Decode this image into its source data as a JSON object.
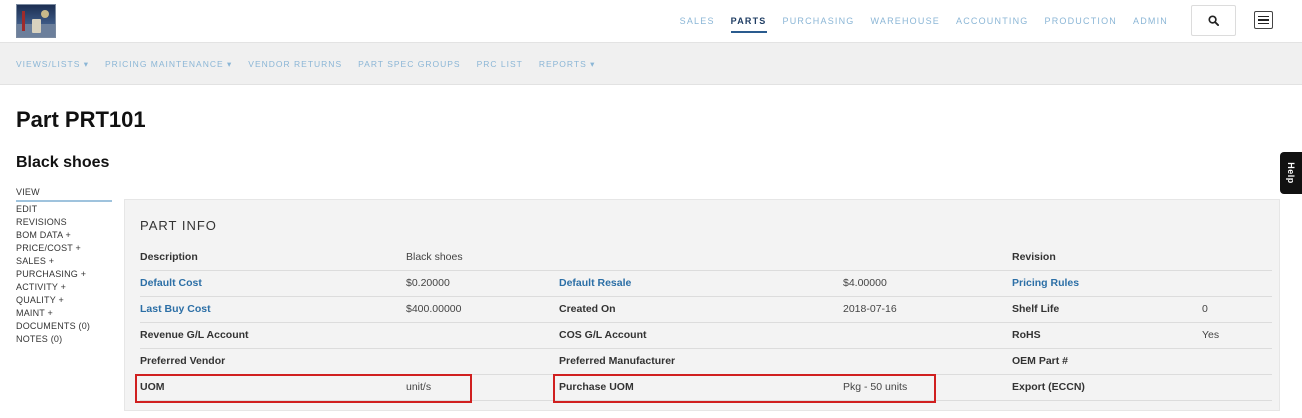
{
  "topnav": {
    "items": [
      "SALES",
      "PARTS",
      "PURCHASING",
      "WAREHOUSE",
      "ACCOUNTING",
      "PRODUCTION",
      "ADMIN"
    ],
    "active": "PARTS"
  },
  "subnav": {
    "items": [
      "VIEWS/LISTS ▾",
      "PRICING MAINTENANCE ▾",
      "VENDOR RETURNS",
      "PART SPEC GROUPS",
      "PRC LIST",
      "REPORTS ▾"
    ]
  },
  "page": {
    "title": "Part PRT101",
    "subtitle": "Black shoes"
  },
  "sidenav": {
    "items": [
      "VIEW",
      "EDIT",
      "REVISIONS",
      "BOM DATA +",
      "PRICE/COST +",
      "SALES +",
      "PURCHASING +",
      "ACTIVITY +",
      "QUALITY +",
      "MAINT +",
      "DOCUMENTS (0)",
      "NOTES (0)"
    ],
    "active": "VIEW"
  },
  "help": {
    "label": "Help"
  },
  "part_info": {
    "title": "PART INFO",
    "rows": [
      [
        {
          "t": "Description",
          "k": "lbl"
        },
        {
          "t": "Black shoes",
          "k": "val"
        },
        {
          "t": "",
          "k": "lbl"
        },
        {
          "t": "",
          "k": "val"
        },
        {
          "t": "Revision",
          "k": "lbl"
        },
        {
          "t": "",
          "k": "val"
        }
      ],
      [
        {
          "t": "Default Cost",
          "k": "link"
        },
        {
          "t": "$0.20000",
          "k": "val"
        },
        {
          "t": "Default Resale",
          "k": "link"
        },
        {
          "t": "$4.00000",
          "k": "val"
        },
        {
          "t": "Pricing Rules",
          "k": "link"
        },
        {
          "t": "",
          "k": "val"
        }
      ],
      [
        {
          "t": "Last Buy Cost",
          "k": "link"
        },
        {
          "t": "$400.00000",
          "k": "val"
        },
        {
          "t": "Created On",
          "k": "lbl"
        },
        {
          "t": "2018-07-16",
          "k": "val"
        },
        {
          "t": "Shelf Life",
          "k": "lbl"
        },
        {
          "t": "0",
          "k": "val"
        }
      ],
      [
        {
          "t": "Revenue G/L Account",
          "k": "lbl"
        },
        {
          "t": "",
          "k": "val"
        },
        {
          "t": "COS G/L Account",
          "k": "lbl"
        },
        {
          "t": "",
          "k": "val"
        },
        {
          "t": "RoHS",
          "k": "lbl"
        },
        {
          "t": "Yes",
          "k": "val"
        }
      ],
      [
        {
          "t": "Preferred Vendor",
          "k": "lbl"
        },
        {
          "t": "",
          "k": "val"
        },
        {
          "t": "Preferred Manufacturer",
          "k": "lbl"
        },
        {
          "t": "",
          "k": "val"
        },
        {
          "t": "OEM Part #",
          "k": "lbl"
        },
        {
          "t": "",
          "k": "val"
        }
      ],
      [
        {
          "t": "UOM",
          "k": "lbl"
        },
        {
          "t": "unit/s",
          "k": "val"
        },
        {
          "t": "Purchase UOM",
          "k": "lbl"
        },
        {
          "t": "Pkg - 50 units",
          "k": "val"
        },
        {
          "t": "Export (ECCN)",
          "k": "lbl"
        },
        {
          "t": "",
          "k": "val"
        }
      ]
    ]
  },
  "colors": {
    "accent": "#2c6fa6",
    "nav_link": "#8bb6d6",
    "highlight": "#d01f1f",
    "panel_bg": "#f3f3f3"
  },
  "icons": {
    "search": "search-icon",
    "menu": "hamburger-menu-icon",
    "logo": "logo-image"
  }
}
